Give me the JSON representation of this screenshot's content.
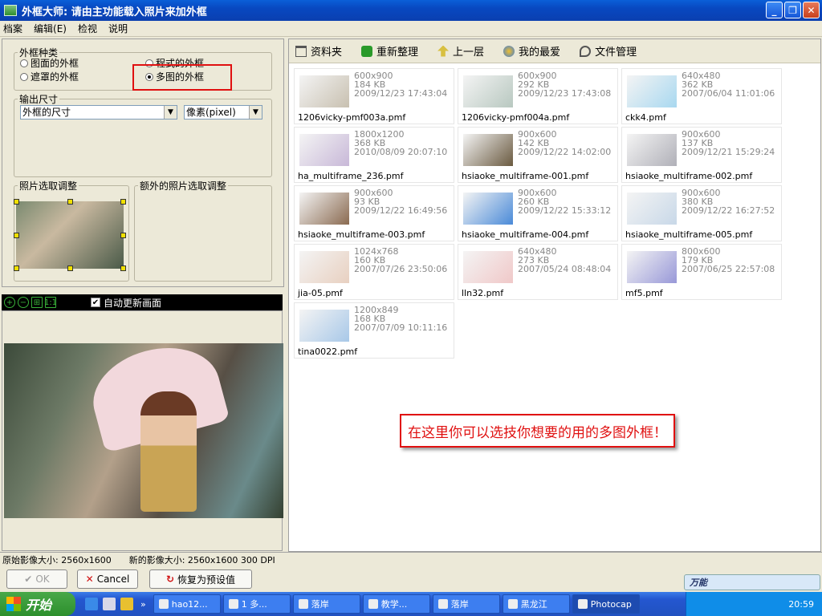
{
  "window": {
    "title": "外框大师: 请由主功能载入照片来加外框",
    "minimize": "_",
    "restore": "❐",
    "close": "✕"
  },
  "menu": [
    "档案",
    "编辑(E)",
    "检视",
    "说明"
  ],
  "frame_type": {
    "legend": "外框种类",
    "options": [
      {
        "label": "图面的外框",
        "selected": false
      },
      {
        "label": "遮罩的外框",
        "selected": false
      },
      {
        "label": "程式的外框",
        "selected": false
      },
      {
        "label": "多图的外框",
        "selected": true
      }
    ]
  },
  "output_size": {
    "legend": "输出尺寸",
    "size_select": "外框的尺寸",
    "unit_select": "像素(pixel)"
  },
  "photo_adjust": {
    "legend": "照片选取调整"
  },
  "extra_adjust": {
    "legend": "额外的照片选取调整"
  },
  "preview": {
    "actual_size_label": "1:1",
    "auto_update_label": "自动更新画面",
    "auto_update_checked": true
  },
  "toolbar": {
    "folder": "资料夹",
    "refresh": "重新整理",
    "up": "上一层",
    "favorites": "我的最爱",
    "file_manager": "文件管理"
  },
  "files": [
    {
      "dims": "600x900",
      "size": "184 KB",
      "date": "2009/12/23 17:43:04",
      "name": "1206vicky-pmf003a.pmf",
      "color": "#c8c0b0"
    },
    {
      "dims": "600x900",
      "size": "292 KB",
      "date": "2009/12/23 17:43:08",
      "name": "1206vicky-pmf004a.pmf",
      "color": "#b8c8c0"
    },
    {
      "dims": "640x480",
      "size": "362 KB",
      "date": "2007/06/04 11:01:06",
      "name": "ckk4.pmf",
      "color": "#a8d8f0"
    },
    {
      "dims": "1800x1200",
      "size": "368 KB",
      "date": "2010/08/09 20:07:10",
      "name": "ha_multiframe_236.pmf",
      "color": "#c8b8d8"
    },
    {
      "dims": "900x600",
      "size": "142 KB",
      "date": "2009/12/22 14:02:00",
      "name": "hsiaoke_multiframe-001.pmf",
      "color": "#6a5a40"
    },
    {
      "dims": "900x600",
      "size": "137 KB",
      "date": "2009/12/21 15:29:24",
      "name": "hsiaoke_multiframe-002.pmf",
      "color": "#b0b0b8"
    },
    {
      "dims": "900x600",
      "size": "93 KB",
      "date": "2009/12/22 16:49:56",
      "name": "hsiaoke_multiframe-003.pmf",
      "color": "#8a6a50"
    },
    {
      "dims": "900x600",
      "size": "260 KB",
      "date": "2009/12/22 15:33:12",
      "name": "hsiaoke_multiframe-004.pmf",
      "color": "#4a8ad8"
    },
    {
      "dims": "900x600",
      "size": "380 KB",
      "date": "2009/12/22 16:27:52",
      "name": "hsiaoke_multiframe-005.pmf",
      "color": "#c8d8e8"
    },
    {
      "dims": "1024x768",
      "size": "160 KB",
      "date": "2007/07/26 23:50:06",
      "name": "jia-05.pmf",
      "color": "#e8d0c0"
    },
    {
      "dims": "640x480",
      "size": "273 KB",
      "date": "2007/05/24 08:48:04",
      "name": "lln32.pmf",
      "color": "#f0c8c8"
    },
    {
      "dims": "800x600",
      "size": "179 KB",
      "date": "2007/06/25 22:57:08",
      "name": "mf5.pmf",
      "color": "#9898d8"
    },
    {
      "dims": "1200x849",
      "size": "168 KB",
      "date": "2007/07/09 10:11:16",
      "name": "tina0022.pmf",
      "color": "#a8c8e8"
    }
  ],
  "annotation": "在这里你可以选技你想要的用的多图外框！",
  "status": {
    "original": "原始影像大小: 2560x1600",
    "new": "新的影像大小: 2560x1600 300 DPI"
  },
  "buttons": {
    "ok": "OK",
    "cancel": "Cancel",
    "reset": "恢复为预设值"
  },
  "taskbar": {
    "start": "开始",
    "tasks": [
      "hao12...",
      "1 多...",
      "落岸",
      "教学...",
      "落岸",
      "黑龙江",
      "Photocap"
    ],
    "active_task": 6,
    "clock": "20:59"
  },
  "imebar": {
    "label": "万能"
  }
}
